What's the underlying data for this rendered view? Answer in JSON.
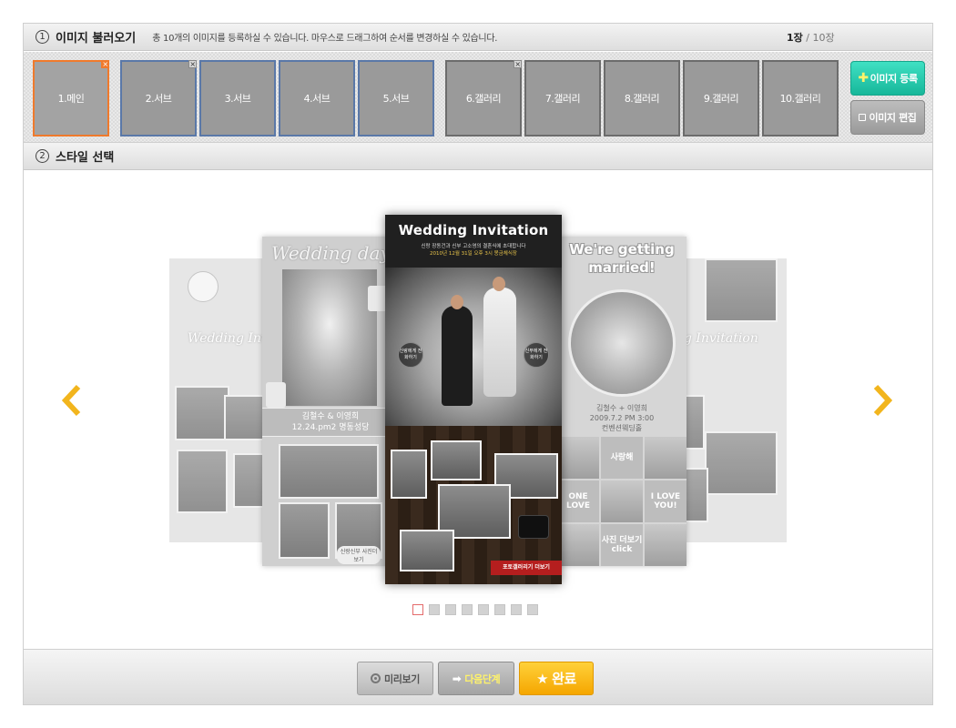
{
  "section1": {
    "number": "1",
    "title": "이미지 불러오기",
    "description": "총 10개의 이미지를 등록하실 수 있습니다. 마우스로 드래그하여 순서를 변경하실 수 있습니다.",
    "count_current": "1장",
    "count_total": "/ 10장"
  },
  "thumbnails": [
    {
      "label": "1.메인",
      "type": "main",
      "remove": "×"
    },
    {
      "label": "2.서브",
      "type": "sub",
      "remove": "×"
    },
    {
      "label": "3.서브",
      "type": "sub"
    },
    {
      "label": "4.서브",
      "type": "sub"
    },
    {
      "label": "5.서브",
      "type": "sub"
    },
    {
      "label": "6.갤러리",
      "type": "gallery",
      "remove": "×"
    },
    {
      "label": "7.갤러리",
      "type": "gallery"
    },
    {
      "label": "8.갤러리",
      "type": "gallery"
    },
    {
      "label": "9.갤러리",
      "type": "gallery"
    },
    {
      "label": "10.갤러리",
      "type": "gallery"
    }
  ],
  "actions": {
    "register_label": "이미지 등록",
    "register_icon": "plus-icon",
    "edit_label": "이미지 편집",
    "edit_icon": "square-icon"
  },
  "section2": {
    "number": "2",
    "title": "스타일 선택"
  },
  "carousel": {
    "prev_icon": "chevron-left-icon",
    "next_icon": "chevron-right-icon",
    "arrow_color": "#f2b51d",
    "far_left": {
      "title": "Wedding Invita"
    },
    "mid_left": {
      "title": "Wedding day",
      "names": "김철수 & 이영희",
      "date": "12.24.pm2 명동성당",
      "call_tag": "신랑신부 사진더보기"
    },
    "center": {
      "title": "Wedding Invitation",
      "line1": "신랑 장동건과 신부 고소영의 결혼식에 초대합니다",
      "line2": "2010년 12월 31일 오후 3시 몽금체식장",
      "call_groom": "신랑에게 전화하기",
      "call_bride": "신부에게 전화하기",
      "more_gallery": "포토갤러리기 더보기"
    },
    "mid_right": {
      "title_line1": "We're getting",
      "title_line2": "married!",
      "names": "김철수 + 이영희",
      "date": "2009.7.2 PM 3:00",
      "venue": "컨벤션웨딩홀",
      "grid_text1": "사랑해",
      "grid_text2": "ONE LOVE",
      "grid_text3": "I LOVE YOU!",
      "grid_text4": "사진 더보기 click"
    },
    "far_right": {
      "title": "Wedding Invitation"
    },
    "page_count": 8,
    "active_page": 1
  },
  "footer": {
    "preview_label": "미리보기",
    "next_label": "다음단계",
    "done_label": "완료",
    "done_icon": "star-icon",
    "next_icon": "arrow-right-icon",
    "preview_icon": "ring-icon"
  }
}
